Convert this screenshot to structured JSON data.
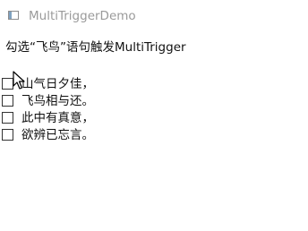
{
  "window": {
    "title": "MultiTriggerDemo",
    "icon": "window-app-icon"
  },
  "instruction": "勾选“飞鸟”语句触发MultiTrigger",
  "poem_lines": [
    {
      "label": "山气日夕佳，",
      "checked": false
    },
    {
      "label": "飞鸟相与还。",
      "checked": false
    },
    {
      "label": "此中有真意，",
      "checked": false
    },
    {
      "label": "欲辨已忘言。",
      "checked": false
    }
  ],
  "cursor": {
    "icon": "mouse-pointer-icon"
  }
}
